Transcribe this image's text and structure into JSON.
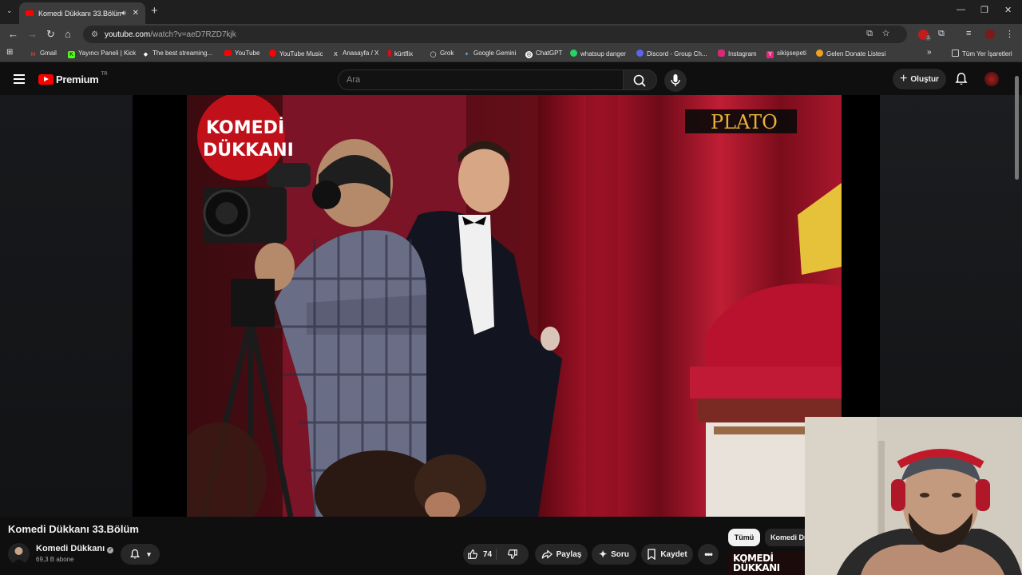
{
  "browser": {
    "tab_title": "Komedi Dükkanı 33.Bölüm",
    "url_domain": "youtube.com",
    "url_path": "/watch?v=aeD7RZD7kjk",
    "bookmarks": [
      "Gmail",
      "Yayıncı Paneli | Kick",
      "The best streaming...",
      "YouTube",
      "YouTube Music",
      "Anasayfa / X",
      "kürtflix",
      "Grok",
      "Google Gemini",
      "ChatGPT",
      "whatsup danger",
      "Discord - Group Ch...",
      "Instagram",
      "sikişsepeti",
      "Gelen Donate Listesi"
    ],
    "all_bookmarks": "Tüm Yer İşaretleri",
    "extension_badge": "2"
  },
  "youtube": {
    "logo_text": "Premium",
    "country_code": "TR",
    "search_placeholder": "Ara",
    "create_label": "Oluştur"
  },
  "video": {
    "show_logo_line1": "KOMEDİ",
    "show_logo_line2": "DÜKKANI",
    "channel_watermark": "PLATO",
    "title": "Komedi Dükkanı 33.Bölüm",
    "channel_name": "Komedi Dükkanı",
    "subscribers": "69,3 B abone",
    "likes": "74",
    "share_label": "Paylaş",
    "ask_label": "Soru",
    "save_label": "Kaydet"
  },
  "chips": [
    "Tümü",
    "Komedi Dü"
  ],
  "thumb_text": "KOMEDİ DÜKKANI",
  "colors": {
    "brand_red": "#ff0000",
    "bg": "#0f0f0f",
    "pill": "#272727"
  }
}
